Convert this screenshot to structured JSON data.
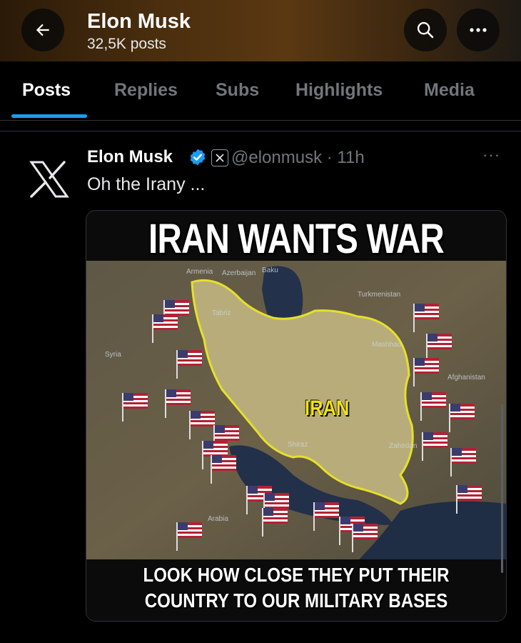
{
  "header": {
    "title": "Elon Musk",
    "post_count": "32,5K posts",
    "icons": {
      "back": "back-arrow-icon",
      "search": "search-icon",
      "more": "more-icon"
    }
  },
  "tabs": [
    {
      "label": "Posts",
      "active": true
    },
    {
      "label": "Replies",
      "active": false
    },
    {
      "label": "Subs",
      "active": false
    },
    {
      "label": "Highlights",
      "active": false
    },
    {
      "label": "Media",
      "active": false
    }
  ],
  "tweet": {
    "author": "Elon Musk",
    "handle": "@elonmusk",
    "time": "11h",
    "handle_time": "@elonmusk · 11h",
    "text": "Oh the Irany ...",
    "more": "···",
    "media": {
      "headline": "IRAN WANTS WAR",
      "map_label": "IRAN",
      "place_labels": {
        "armenia": "Armenia",
        "azerbaijan": "Azerbaijan",
        "baku": "Baku",
        "turkmenistan": "Turkmenistan",
        "tabriz": "Tabriz",
        "mashhad": "Mashhad",
        "afghanistan": "Afghanistan",
        "shiraz": "Shiraz",
        "zahedan": "Zahedan",
        "arabia": "Arabia",
        "syria": "Syria"
      },
      "caption_line1": "LOOK HOW CLOSE THEY PUT THEIR",
      "caption_line2": "COUNTRY TO OUR MILITARY BASES"
    }
  },
  "colors": {
    "accent": "#1d9bf0",
    "iran_fill": "#b8ad7a",
    "iran_border": "#e6e02a",
    "headline": "#ffffff",
    "label_yellow": "#f2e313"
  }
}
